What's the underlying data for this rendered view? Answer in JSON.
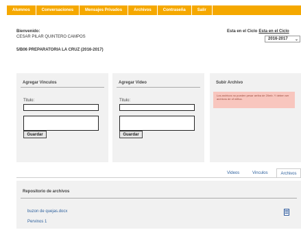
{
  "nav": {
    "items": [
      "Alumnos",
      "Conversaciones",
      "Mensajes Privados",
      "Archivos",
      "Contraseña",
      "Salir"
    ]
  },
  "welcome": {
    "label": "Bienvenido:",
    "name": "CESAR PILAR QUINTERO CAMPOS",
    "school": "5/B06 PREPARATORIA LA CRUZ (2016-2017)"
  },
  "cycle": {
    "label": "Esta en el Ciclo",
    "link": "Esta en el Ciclo",
    "selected": "2016-2017"
  },
  "panels": {
    "vinculo": {
      "title": "Agregar Vinculos",
      "field_label": "Titulo:",
      "button": "Guardar"
    },
    "video": {
      "title": "Agregar Video",
      "field_label": "Titulo:",
      "button": "Guardar"
    },
    "archivo": {
      "title": "Subir Archivo",
      "notice": "Los archivos no pueden pesar arriba de 20mb. Y deben ser archivos de of mifica."
    }
  },
  "tabs": {
    "videos": "Videos",
    "vinculos": "Vinculos",
    "archivos": "Archivos"
  },
  "repo": {
    "title": "Repositorio de archivos",
    "files": [
      "buzon de quejas.docx"
    ],
    "pagination": "Pervinos 1"
  },
  "colors": {
    "nav": "#f5a800",
    "panel": "#f1f1f1",
    "notice": "#f8c6be",
    "link": "#2c5f9c"
  }
}
